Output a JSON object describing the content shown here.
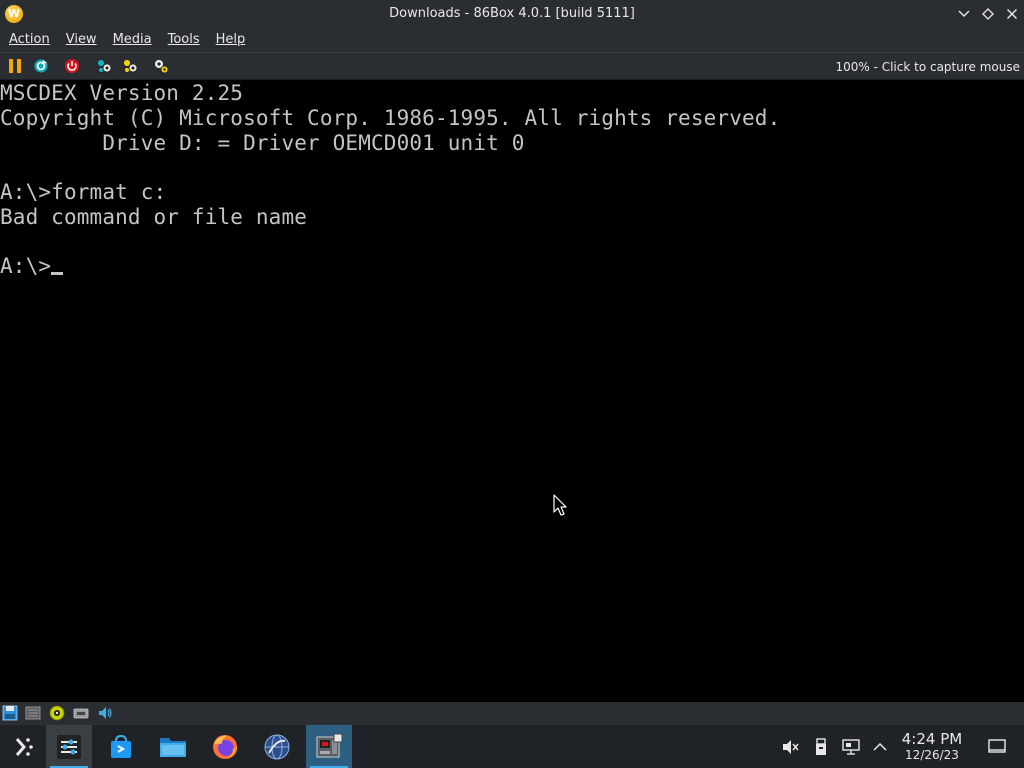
{
  "window": {
    "title": "Downloads - 86Box 4.0.1 [build 5111]",
    "app_icon_letter": "W"
  },
  "menu": [
    "Action",
    "View",
    "Media",
    "Tools",
    "Help"
  ],
  "toolbar": {
    "buttons": [
      "pause-icon",
      "reset-icon",
      "power-icon",
      "settings-icon",
      "hard-reset-icon",
      "config-icon"
    ],
    "capture_hint": "100% - Click to capture mouse"
  },
  "dos": {
    "lines": [
      "MSCDEX Version 2.25",
      "Copyright (C) Microsoft Corp. 1986-1995. All rights reserved.",
      "        Drive D: = Driver OEMCD001 unit 0",
      "",
      "A:\\>format c:",
      "Bad command or file name",
      ""
    ],
    "prompt": "A:\\>",
    "text_color": "#c4c4c4"
  },
  "statusbar": {
    "icons": [
      "floppy-icon",
      "hard-disk-icon",
      "cdrom-icon",
      "network-icon",
      "sound-icon"
    ]
  },
  "taskbar": {
    "apps": [
      "app-launcher-icon",
      "system-settings-icon",
      "discover-icon",
      "dolphin-icon",
      "firefox-icon",
      "browser-icon",
      "86box-icon"
    ],
    "tray": [
      "volume-muted-icon",
      "removable-device-icon",
      "network-wired-icon",
      "chevron-up-icon"
    ],
    "clock": {
      "time": "4:24 PM",
      "date": "12/26/23"
    },
    "accent": "#3daee9"
  }
}
